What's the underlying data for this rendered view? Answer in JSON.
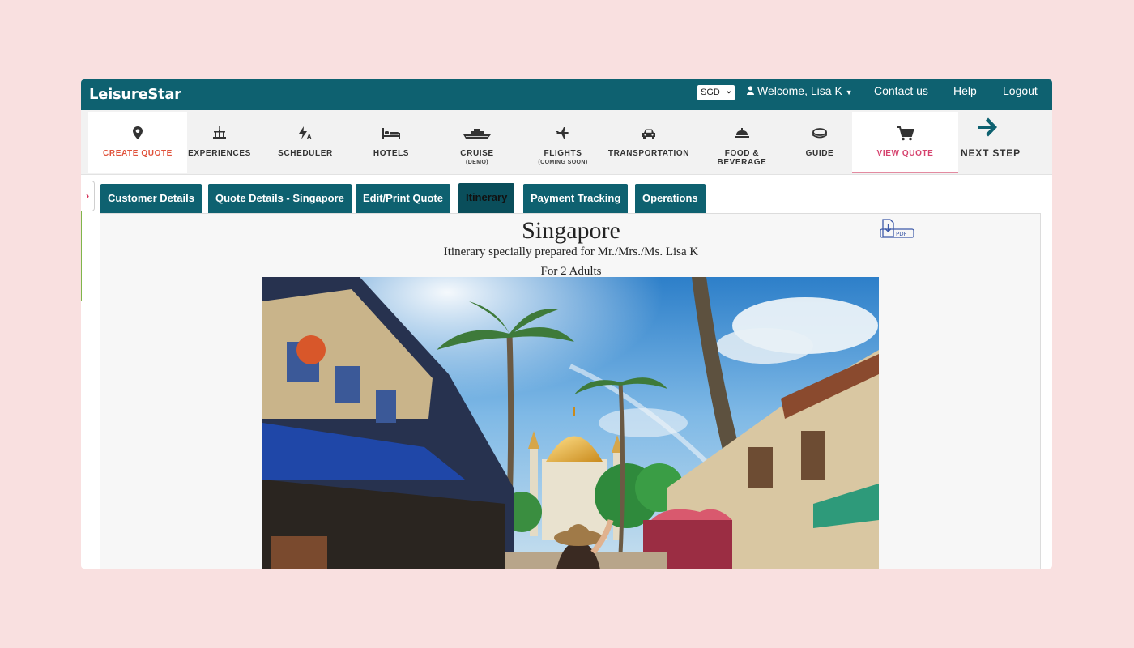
{
  "app": {
    "brand": "LeisureStar"
  },
  "topbar": {
    "currency": "SGD",
    "welcome": "Welcome, Lisa K",
    "links": [
      "Contact us",
      "Help",
      "Logout"
    ]
  },
  "nav": {
    "items": [
      {
        "label": "CREATE QUOTE",
        "icon": "map-pin-icon"
      },
      {
        "label": "EXPERIENCES",
        "icon": "landmark-icon"
      },
      {
        "label": "SCHEDULER",
        "icon": "scheduler-icon"
      },
      {
        "label": "HOTELS",
        "icon": "bed-icon"
      },
      {
        "label": "CRUISE",
        "sub": "(DEMO)",
        "icon": "ship-icon"
      },
      {
        "label": "FLIGHTS",
        "sub": "(COMING SOON)",
        "icon": "plane-icon"
      },
      {
        "label": "TRANSPORTATION",
        "icon": "car-icon"
      },
      {
        "label": "FOOD & BEVERAGE",
        "icon": "food-icon"
      },
      {
        "label": "GUIDE",
        "icon": "guide-icon"
      },
      {
        "label": "VIEW QUOTE",
        "icon": "cart-icon"
      }
    ],
    "next_step": "NEXT STEP"
  },
  "tabs": [
    "Customer Details",
    "Quote Details - Singapore",
    "Edit/Print Quote",
    "Itinerary",
    "Payment Tracking",
    "Operations"
  ],
  "itinerary": {
    "city": "Singapore",
    "prepared_for": "Itinerary specially prepared for Mr./Mrs./Ms. Lisa K",
    "travellers": "For 2 Adults",
    "pdf_label": "PDF"
  },
  "colors": {
    "brand": "#0e6170",
    "accent_red": "#e0533c",
    "accent_pink": "#d6436e"
  }
}
